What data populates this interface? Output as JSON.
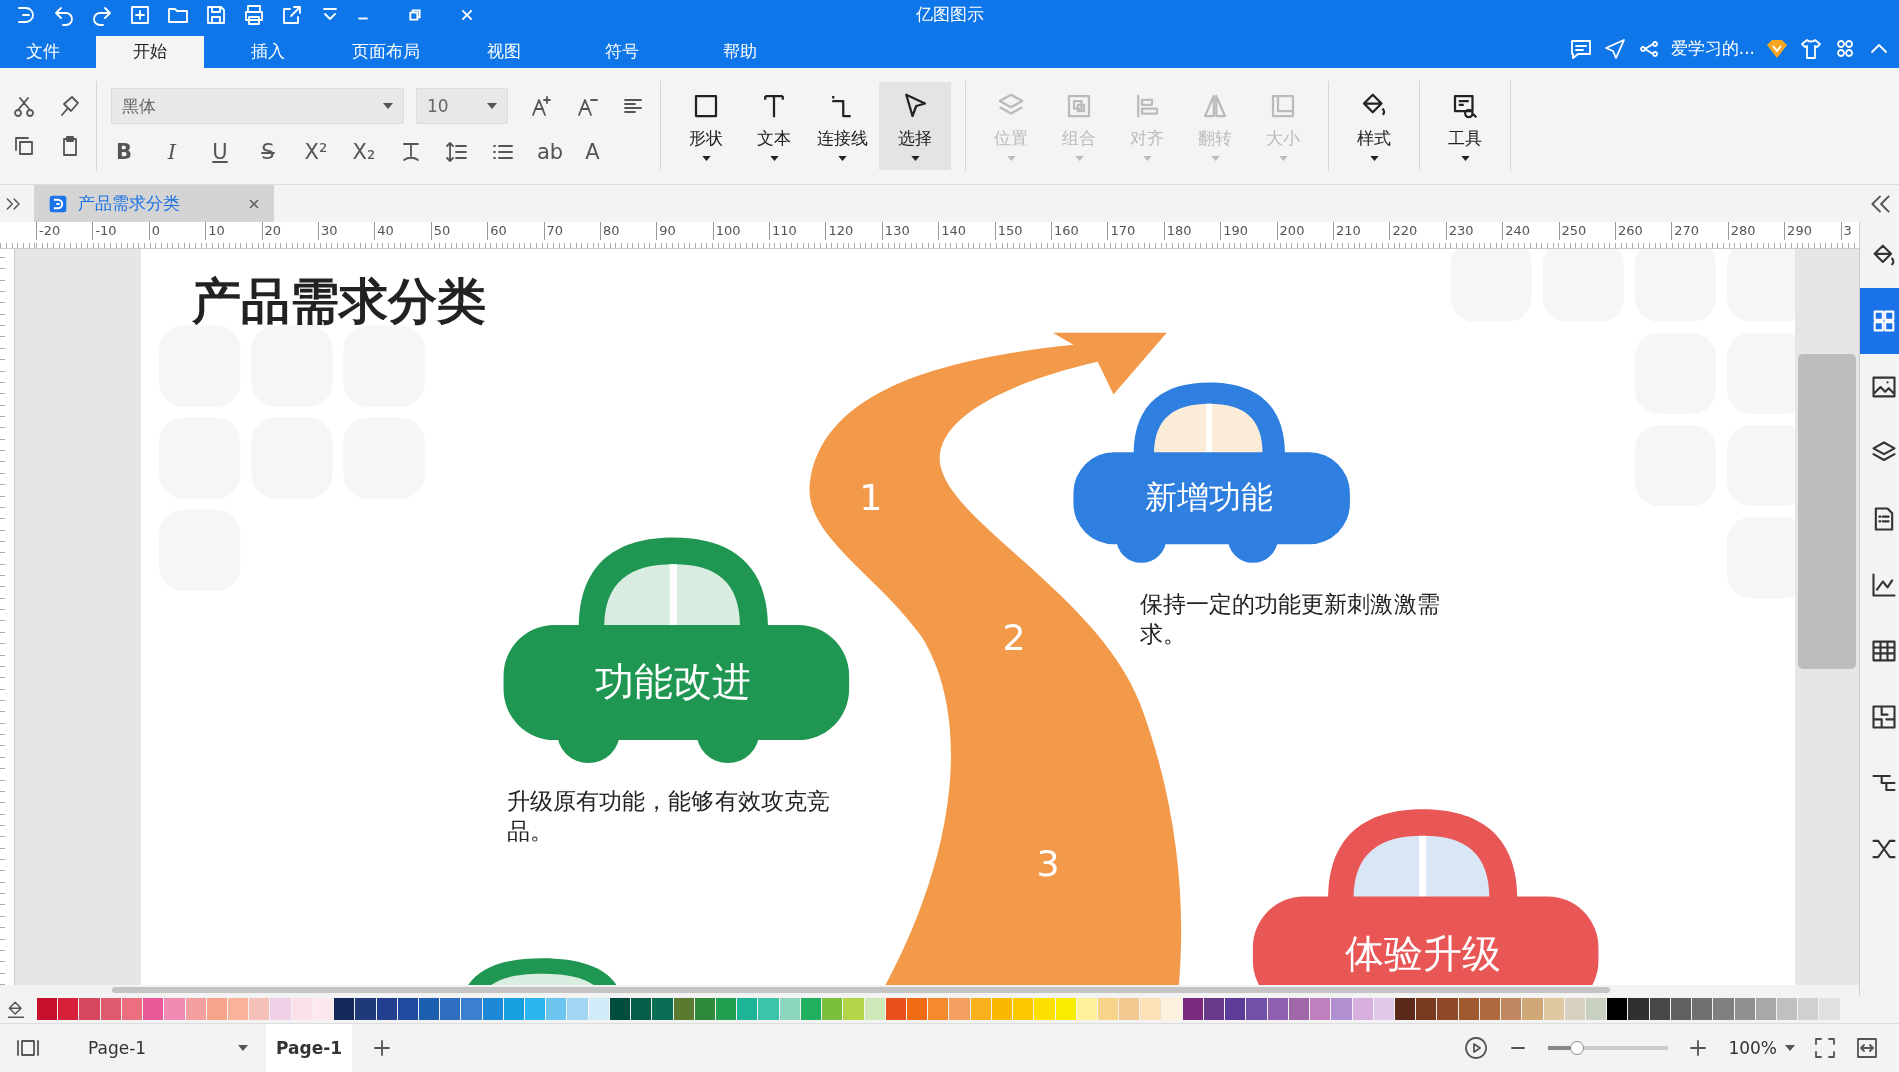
{
  "title_bar": {
    "title": "亿图图示"
  },
  "menu_tabs": [
    {
      "label": "文件",
      "selected": false
    },
    {
      "label": "开始",
      "selected": true
    },
    {
      "label": "插入",
      "selected": false
    },
    {
      "label": "页面布局",
      "selected": false
    },
    {
      "label": "视图",
      "selected": false
    },
    {
      "label": "符号",
      "selected": false
    },
    {
      "label": "帮助",
      "selected": false
    }
  ],
  "account": {
    "user": "爱学习的..."
  },
  "toolbar": {
    "font_family": "黑体",
    "font_size": "10",
    "format_buttons": [
      "B",
      "I",
      "U",
      "S",
      "X²",
      "X₂"
    ],
    "color_buttons": [
      "ab",
      "A"
    ],
    "big_buttons": [
      {
        "label": "形状",
        "disabled": false,
        "selected": false
      },
      {
        "label": "文本",
        "disabled": false,
        "selected": false
      },
      {
        "label": "连接线",
        "disabled": false,
        "selected": false
      },
      {
        "label": "选择",
        "disabled": false,
        "selected": true
      },
      {
        "label": "位置",
        "disabled": true,
        "selected": false
      },
      {
        "label": "组合",
        "disabled": true,
        "selected": false
      },
      {
        "label": "对齐",
        "disabled": true,
        "selected": false
      },
      {
        "label": "翻转",
        "disabled": true,
        "selected": false
      },
      {
        "label": "大小",
        "disabled": true,
        "selected": false
      },
      {
        "label": "样式",
        "disabled": false,
        "selected": false
      },
      {
        "label": "工具",
        "disabled": false,
        "selected": false
      }
    ]
  },
  "doc_tabs": [
    {
      "title": "产品需求分类",
      "selected": true
    }
  ],
  "ruler": {
    "labels": [
      "-20",
      "-10",
      "0",
      "10",
      "20",
      "30",
      "40",
      "50",
      "60",
      "70",
      "80",
      "90",
      "100",
      "110",
      "120",
      "130",
      "140",
      "150",
      "160",
      "170",
      "180",
      "190",
      "200",
      "210",
      "220",
      "230",
      "240",
      "250",
      "260",
      "270",
      "280",
      "290",
      "3"
    ]
  },
  "canvas": {
    "title": "产品需求分类",
    "steps": [
      "1",
      "2",
      "3"
    ],
    "cars": [
      {
        "label": "功能改进",
        "description": "升级原有功能，能够有效攻克竞品。",
        "color": "#1f9651"
      },
      {
        "label": "新增功能",
        "description": "保持一定的功能更新刺激激需求。",
        "color": "#2f7fe0"
      },
      {
        "label": "体验升级",
        "color": "#e85656"
      },
      {
        "color": "#1f9651"
      }
    ]
  },
  "palette": [
    {
      "color": "#c8102e"
    },
    {
      "color": "#d6203a"
    },
    {
      "color": "#d4475f"
    },
    {
      "color": "#e05a6e"
    },
    {
      "color": "#ec6f80"
    },
    {
      "color": "#ea5a9a"
    },
    {
      "color": "#f08cb4"
    },
    {
      "color": "#f5a0a0"
    },
    {
      "color": "#f7a58a"
    },
    {
      "color": "#f9b39a"
    },
    {
      "color": "#f4c0b8"
    },
    {
      "color": "#f0d0e8"
    },
    {
      "color": "#fbe0ea"
    },
    {
      "color": "#fde8ef"
    },
    {
      "color": "#14285a"
    },
    {
      "color": "#1e3a78"
    },
    {
      "color": "#233f8f"
    },
    {
      "color": "#1f4aa0"
    },
    {
      "color": "#1b5fae"
    },
    {
      "color": "#2e6fc2"
    },
    {
      "color": "#3a7fd0"
    },
    {
      "color": "#1e88d8"
    },
    {
      "color": "#16a0e0"
    },
    {
      "color": "#2cb6ef"
    },
    {
      "color": "#6cc6f0"
    },
    {
      "color": "#a0d6f2"
    },
    {
      "color": "#d0ecf8"
    },
    {
      "color": "#004d3d"
    },
    {
      "color": "#075e48"
    },
    {
      "color": "#0a6e55"
    },
    {
      "color": "#5a7a30"
    },
    {
      "color": "#2d8a3a"
    },
    {
      "color": "#20a050"
    },
    {
      "color": "#1db596"
    },
    {
      "color": "#3cc4a8"
    },
    {
      "color": "#8cd6c0"
    },
    {
      "color": "#20b060"
    },
    {
      "color": "#7cbf3c"
    },
    {
      "color": "#b4d44a"
    },
    {
      "color": "#cfe8b8"
    },
    {
      "color": "#e8501e"
    },
    {
      "color": "#f06c14"
    },
    {
      "color": "#f48a2c"
    },
    {
      "color": "#f4a060"
    },
    {
      "color": "#f8b01c"
    },
    {
      "color": "#fbb800"
    },
    {
      "color": "#fcc800"
    },
    {
      "color": "#fde000"
    },
    {
      "color": "#f8ec00"
    },
    {
      "color": "#fff09a"
    },
    {
      "color": "#f8d48a"
    },
    {
      "color": "#f0c890"
    },
    {
      "color": "#fbe0b8"
    },
    {
      "color": "#fdf0dc"
    },
    {
      "color": "#7b2a7e"
    },
    {
      "color": "#6a3a8a"
    },
    {
      "color": "#5c3c98"
    },
    {
      "color": "#7050a8"
    },
    {
      "color": "#9060b0"
    },
    {
      "color": "#a068a8"
    },
    {
      "color": "#c080c0"
    },
    {
      "color": "#b090d0"
    },
    {
      "color": "#d8b0e0"
    },
    {
      "color": "#e0c8e8"
    },
    {
      "color": "#5c2a1a"
    },
    {
      "color": "#7a3a20"
    },
    {
      "color": "#8e4a28"
    },
    {
      "color": "#a05a30"
    },
    {
      "color": "#b06a40"
    },
    {
      "color": "#c08860"
    },
    {
      "color": "#d0a878"
    },
    {
      "color": "#e0c8a0"
    },
    {
      "color": "#d8d0c0"
    },
    {
      "color": "#c8d0c0"
    },
    {
      "color": "#000000"
    },
    {
      "color": "#303030"
    },
    {
      "color": "#484848"
    },
    {
      "color": "#606060"
    },
    {
      "color": "#707070"
    },
    {
      "color": "#808080"
    },
    {
      "color": "#909090"
    },
    {
      "color": "#a8a8a8"
    },
    {
      "color": "#c0c0c0"
    },
    {
      "color": "#d0d0d0"
    },
    {
      "color": "#e0e0e0"
    }
  ],
  "status_bar": {
    "page_select": "Page-1",
    "pages": [
      {
        "label": "Page-1",
        "selected": true
      }
    ],
    "zoom": "100%",
    "zoom_slider": {
      "level": 0.25
    }
  }
}
